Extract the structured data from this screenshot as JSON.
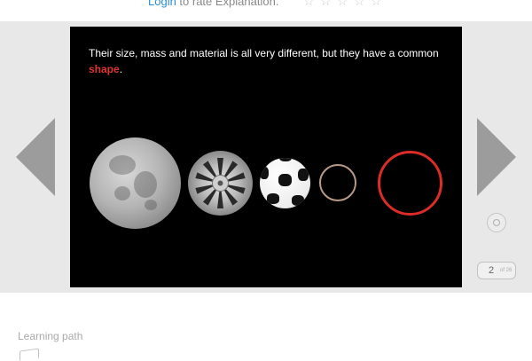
{
  "rating": {
    "login_link": "Login",
    "prompt": " to rate Explanation.",
    "stars": [
      "☆",
      "☆",
      "☆",
      "☆",
      "☆"
    ]
  },
  "slideshow": {
    "caption_text": "Their size, mass and material is all very different, but they have a common ",
    "caption_highlight": "shape",
    "caption_end": ".",
    "current_slide": "2",
    "total_label": "of 26",
    "objects": [
      "moon",
      "wheel",
      "soccer-ball",
      "ring",
      "circle"
    ]
  },
  "colors": {
    "link": "#2a8fd8",
    "highlight": "#e0342f",
    "circle": "#dd2c28",
    "stage_bg": "#e8e8e8",
    "arrow": "#9c9c9c"
  },
  "learning_path": {
    "label": "Learning path"
  },
  "icons": {
    "prev": "left-triangle-icon",
    "next": "right-triangle-icon",
    "zoom": "zoom-circle-icon",
    "learning_path": "path-icon"
  }
}
